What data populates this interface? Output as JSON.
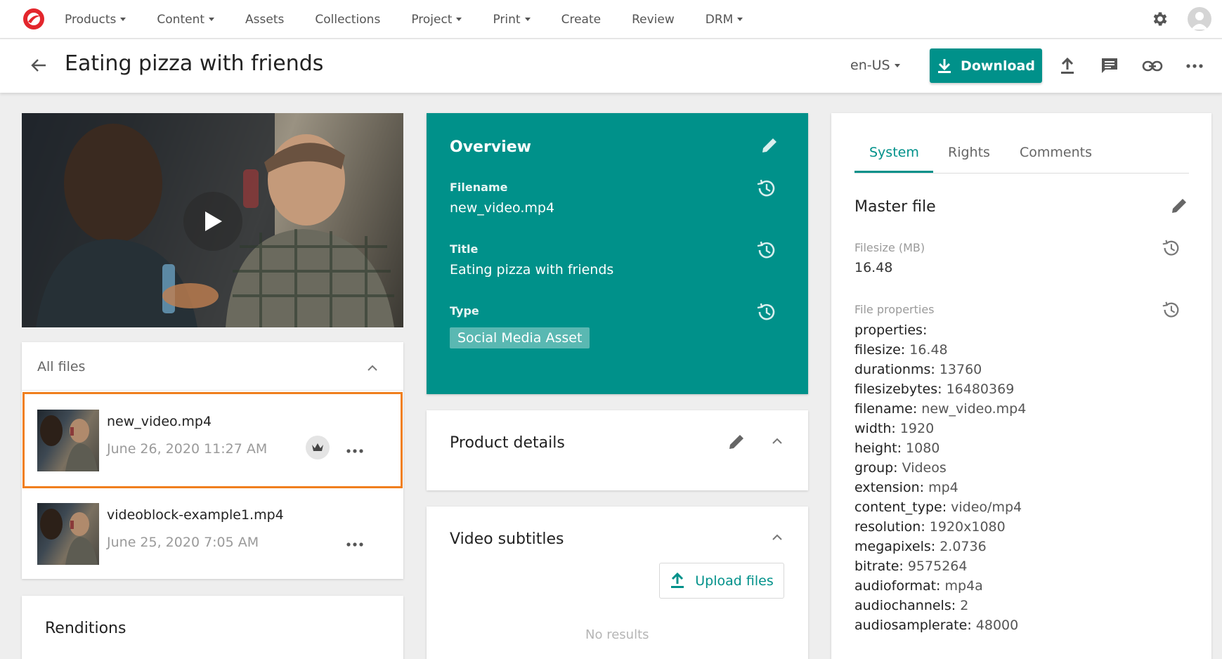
{
  "nav": {
    "items": [
      {
        "label": "Products",
        "dropdown": true
      },
      {
        "label": "Content",
        "dropdown": true
      },
      {
        "label": "Assets",
        "dropdown": false
      },
      {
        "label": "Collections",
        "dropdown": false
      },
      {
        "label": "Project",
        "dropdown": true
      },
      {
        "label": "Print",
        "dropdown": true
      },
      {
        "label": "Create",
        "dropdown": false
      },
      {
        "label": "Review",
        "dropdown": false
      },
      {
        "label": "DRM",
        "dropdown": true
      }
    ],
    "icons": [
      "logo-icon",
      "gear-icon",
      "avatar-icon"
    ]
  },
  "header": {
    "title": "Eating pizza with friends",
    "locale": "en-US",
    "download_label": "Download",
    "accent_color": "#00918a"
  },
  "files": {
    "heading": "All files",
    "items": [
      {
        "name": "new_video.mp4",
        "date": "June 26, 2020 11:27 AM",
        "master": true,
        "selected": true
      },
      {
        "name": "videoblock-example1.mp4",
        "date": "June 25, 2020 7:05 AM",
        "master": false,
        "selected": false
      }
    ]
  },
  "renditions": {
    "heading": "Renditions"
  },
  "overview": {
    "title": "Overview",
    "filename_label": "Filename",
    "filename_value": "new_video.mp4",
    "title_label": "Title",
    "title_value": "Eating pizza with friends",
    "type_label": "Type",
    "type_value": "Social Media Asset"
  },
  "product_details": {
    "heading": "Product details"
  },
  "video_subtitles": {
    "heading": "Video subtitles",
    "upload_label": "Upload files",
    "empty_text": "No results"
  },
  "right_panel": {
    "tabs": [
      "System",
      "Rights",
      "Comments"
    ],
    "active_tab": "System",
    "master_file_title": "Master file",
    "filesize_label": "Filesize (MB)",
    "filesize_value": "16.48",
    "file_properties_label": "File properties",
    "properties": [
      {
        "key": "properties:",
        "value": ""
      },
      {
        "key": "filesize:",
        "value": "16.48"
      },
      {
        "key": "durationms:",
        "value": "13760"
      },
      {
        "key": "filesizebytes:",
        "value": "16480369"
      },
      {
        "key": "filename:",
        "value": "new_video.mp4"
      },
      {
        "key": "width:",
        "value": "1920"
      },
      {
        "key": "height:",
        "value": "1080"
      },
      {
        "key": "group:",
        "value": "Videos"
      },
      {
        "key": "extension:",
        "value": "mp4"
      },
      {
        "key": "content_type:",
        "value": "video/mp4"
      },
      {
        "key": "resolution:",
        "value": "1920x1080"
      },
      {
        "key": "megapixels:",
        "value": "2.0736"
      },
      {
        "key": "bitrate:",
        "value": "9575264"
      },
      {
        "key": "audioformat:",
        "value": "mp4a"
      },
      {
        "key": "audiochannels:",
        "value": "2"
      },
      {
        "key": "audiosamplerate:",
        "value": "48000"
      }
    ]
  }
}
